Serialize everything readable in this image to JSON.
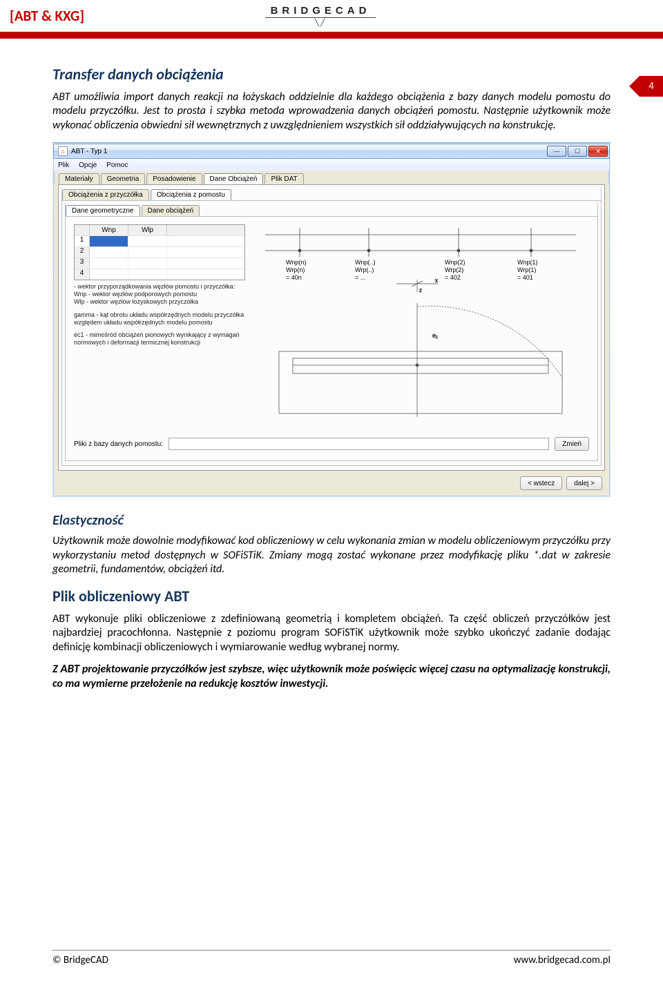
{
  "header": {
    "left_bracket": "[ABT & KXG]",
    "logo_top": "BRIDGECAD"
  },
  "pagenum": "4",
  "section1": {
    "title": "Transfer danych obciążenia",
    "para": "ABT umożliwia import danych reakcji na łożyskach oddzielnie dla każdego obciążenia z bazy danych modelu pomostu do modelu przyczółku. Jest to prosta i szybka metoda wprowadzenia danych obciążeń pomostu. Następnie użytkownik może wykonać obliczenia obwiedni sił wewnętrznych z uwzględnieniem wszystkich sił oddziaływujących na konstrukcję."
  },
  "app": {
    "title": "ABT - Typ 1",
    "menus": [
      "Plik",
      "Opcje",
      "Pomoc"
    ],
    "tabs1": [
      "Materiały",
      "Geometria",
      "Posadowienie",
      "Dane Obciążeń",
      "Plik DAT"
    ],
    "tabs1_sel": 3,
    "tabs2": [
      "Obciążenia z przyczółka",
      "Obciążenia z pomostu"
    ],
    "tabs2_sel": 1,
    "tabs3": [
      "Dane geometryczne",
      "Dane obciążeń"
    ],
    "tabs3_sel": 0,
    "table": {
      "headers": [
        "",
        "Wnp",
        "Wlp"
      ],
      "rows": [
        "1",
        "2",
        "3",
        "4"
      ]
    },
    "notes": {
      "n1a": "- wektor przyporządkowania węzłów pomostu i przyczółka:",
      "n1b": "Wnp - wektor węzłów podporowych pomostu",
      "n1c": "Wlp - wektor węzłów łożyskowych przyczółka",
      "n2": "gamma - kąt obrotu układu współrzędnych modelu przyczółka względem układu współrzędnych modelu pomostu",
      "n3": "ec1 - mimośród obciążeń pionowych wynikający z wymagań normowych i deformacji termicznej konstrukcji"
    },
    "diag": {
      "c4a": "Wnp(n)",
      "c4b": "Wrp(n)",
      "c4c": "= 40n",
      "c3a": "Wnp(..)",
      "c3b": "Wrp(..)",
      "c3c": "= ...",
      "c2a": "Wnp(2)",
      "c2b": "Wrp(2)",
      "c2c": "= 402",
      "c1a": "Wnp(1)",
      "c1b": "Wrp(1)",
      "c1c": "= 401"
    },
    "file_label": "Pliki z bazy danych pomostu:",
    "file_value": "",
    "btn_change": "Zmień",
    "btn_back": "< wstecz",
    "btn_next": "dalej >"
  },
  "section2": {
    "title": "Elastyczność",
    "para": "Użytkownik może dowolnie modyfikować kod obliczeniowy w celu wykonania zmian w modelu obliczeniowym przyczółku przy wykorzystaniu metod dostępnych w SOFiSTiK. Zmiany mogą zostać wykonane przez modyfikację pliku *.dat w zakresie geometrii, fundamentów, obciążeń itd."
  },
  "section3": {
    "title": "Plik obliczeniowy ABT",
    "para": "ABT wykonuje pliki obliczeniowe z zdefiniowaną geometrią i kompletem obciążeń. Ta część obliczeń przyczółków jest najbardziej pracochłonna. Następnie z poziomu program SOFiSTiK użytkownik może szybko ukończyć zadanie dodając definicję kombinacji obliczeniowych i wymiarowanie według wybranej normy.",
    "para2_lead": "Z ",
    "para2_abt": "ABT",
    "para2_rest": " projektowanie przyczółków jest szybsze, więc użytkownik może poświęcic więcej czasu na optymalizację konstrukcji, co ma wymierne przełożenie na redukcję kosztów inwestycji."
  },
  "footer": {
    "left": "© BridgeCAD",
    "right": "www.bridgecad.com.pl"
  }
}
